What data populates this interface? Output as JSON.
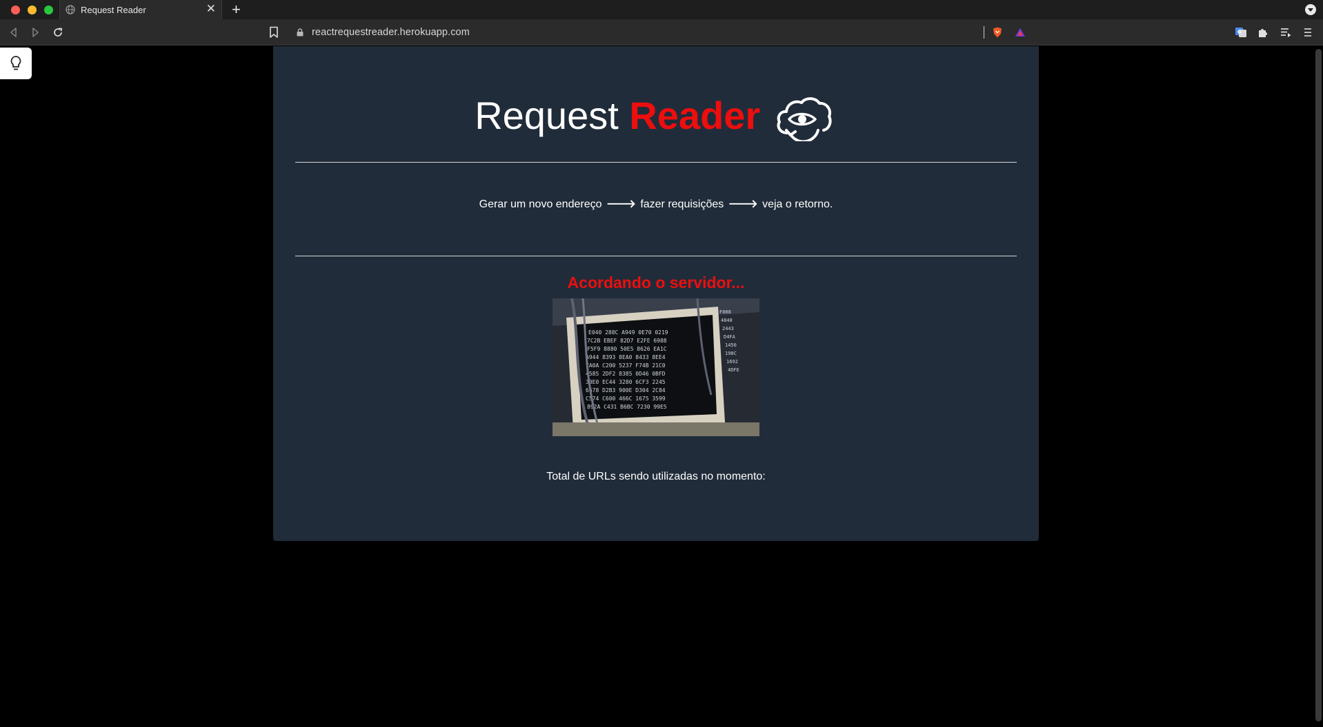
{
  "browser": {
    "tab_title": "Request Reader",
    "tab_close": "✕",
    "new_tab": "+",
    "url": "reactrequestreader.herokuapp.com"
  },
  "page": {
    "title_plain": "Request",
    "title_brand": "Reader",
    "steps": {
      "step1": "Gerar um novo endereço",
      "step2": "fazer requisições",
      "step3": "veja o retorno."
    },
    "arrow": "🡒",
    "status": "Acordando o servidor...",
    "footer": "Total de URLs sendo utilizadas no momento:"
  },
  "colors": {
    "brand_red": "#ed0e0e",
    "card_bg": "#212c3a"
  },
  "icons": {
    "logo": "cloud-eye-refresh-icon",
    "hint": "lightbulb-icon",
    "lock": "lock-icon"
  }
}
